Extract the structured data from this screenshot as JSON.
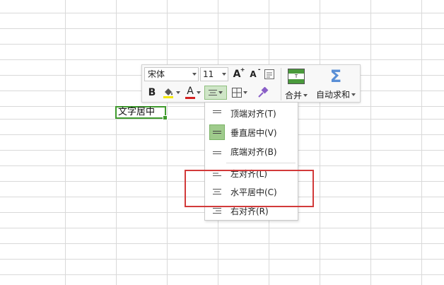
{
  "sheet": {
    "selected_cell_text": "文字居中"
  },
  "toolbar": {
    "font_name": "宋体",
    "font_size": "11",
    "bold_label": "B",
    "font_color_label": "A",
    "increase_font_label": "A",
    "decrease_font_label": "A",
    "merge_label": "合并",
    "autosum_label": "自动求和",
    "colors": {
      "fill_highlight": "#f2e600",
      "font_color": "#d32020",
      "sum_icon": "#5a8fd6",
      "cell_border": "#3f9a2d",
      "annotation": "#d23a3a"
    }
  },
  "align_menu": {
    "items": [
      {
        "label": "顶端对齐(T)",
        "icon": "align-top-icon",
        "checked": false
      },
      {
        "label": "垂直居中(V)",
        "icon": "align-middle-icon",
        "checked": true
      },
      {
        "label": "底端对齐(B)",
        "icon": "align-bottom-icon",
        "checked": false
      },
      {
        "label": "左对齐(L)",
        "icon": "align-left-icon",
        "checked": false
      },
      {
        "label": "水平居中(C)",
        "icon": "align-center-icon",
        "checked": false
      },
      {
        "label": "右对齐(R)",
        "icon": "align-right-icon",
        "checked": false
      }
    ]
  }
}
